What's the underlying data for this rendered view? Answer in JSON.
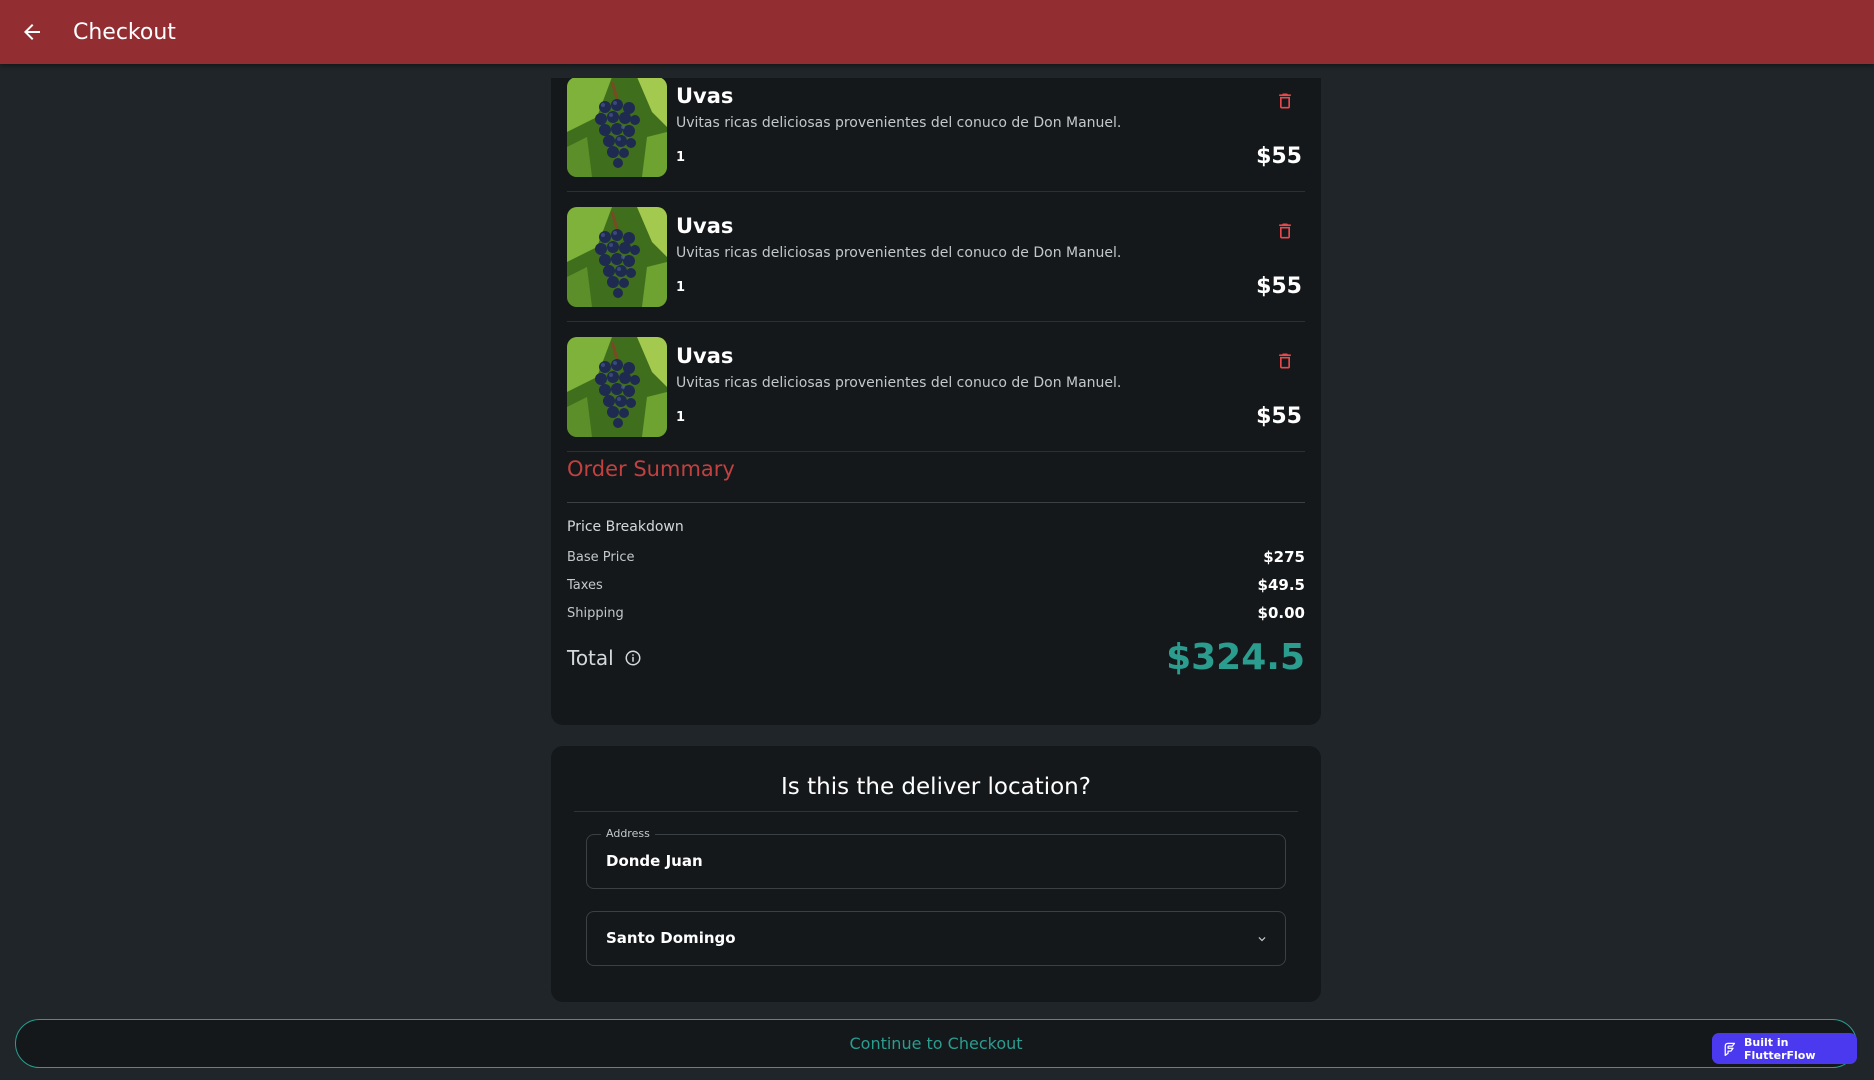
{
  "appbar": {
    "title": "Checkout"
  },
  "cart": {
    "items": [
      {
        "name": "Uvas",
        "description": "Uvitas ricas deliciosas provenientes del conuco de Don Manuel.",
        "quantity": "1",
        "price": "$55"
      },
      {
        "name": "Uvas",
        "description": "Uvitas ricas deliciosas provenientes del conuco de Don Manuel.",
        "quantity": "1",
        "price": "$55"
      },
      {
        "name": "Uvas",
        "description": "Uvitas ricas deliciosas provenientes del conuco de Don Manuel.",
        "quantity": "1",
        "price": "$55"
      }
    ]
  },
  "summary": {
    "title": "Order Summary",
    "breakdown_label": "Price Breakdown",
    "rows": [
      {
        "label": "Base Price",
        "value": "$275"
      },
      {
        "label": "Taxes",
        "value": "$49.5"
      },
      {
        "label": "Shipping",
        "value": "$0.00"
      }
    ],
    "total_label": "Total",
    "total_value": "$324.5"
  },
  "location": {
    "title": "Is this the deliver location?",
    "address_label": "Address",
    "address_value": "Donde Juan",
    "city_value": "Santo Domingo"
  },
  "checkout": {
    "button_label": "Continue to Checkout"
  },
  "badge": {
    "label": "Built in FlutterFlow"
  },
  "colors": {
    "appbar": "#922d31",
    "accent_teal": "#2a9d8f",
    "accent_red": "#c2403f",
    "card_bg": "#14181b",
    "page_bg": "#1f2528",
    "delete_icon": "#e5484d",
    "badge_bg": "#4b39ef"
  },
  "icons": {
    "back": "arrow-left-icon",
    "delete": "trash-icon",
    "info": "info-icon",
    "dropdown": "chevron-down-icon",
    "flutterflow": "flutterflow-logo-icon"
  }
}
